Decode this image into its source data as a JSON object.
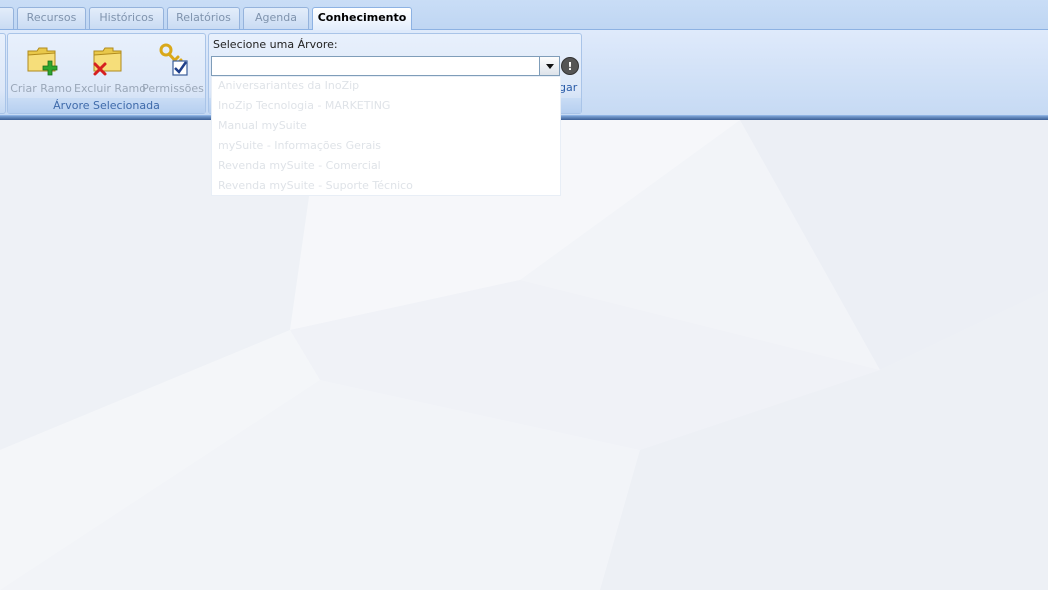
{
  "tabs": [
    {
      "label": "",
      "active": false
    },
    {
      "label": "Recursos",
      "active": false
    },
    {
      "label": "Históricos",
      "active": false
    },
    {
      "label": "Relatórios",
      "active": false
    },
    {
      "label": "Agenda",
      "active": false
    },
    {
      "label": "Conhecimento",
      "active": true
    }
  ],
  "ribbon": {
    "group_caption": "Árvore Selecionada",
    "buttons": [
      {
        "label": "Criar Ramo",
        "icon": "folder-add-icon"
      },
      {
        "label": "Excluir Ramo",
        "icon": "folder-delete-icon"
      },
      {
        "label": "Permissões",
        "icon": "key-check-icon"
      }
    ],
    "tree_select_label": "Selecione uma Árvore:",
    "tree_select_value": "",
    "partial_button_text": "gar"
  },
  "dropdown": {
    "items": [
      "Aniversariantes da InoZip",
      "InoZip Tecnologia - MARKETING",
      "Manual mySuite",
      "mySuite - Informações Gerais",
      "Revenda mySuite - Comercial",
      "Revenda mySuite - Suporte Técnico"
    ]
  },
  "colors": {
    "ribbon_bg": "#dfeafb",
    "tab_active_text": "#000000",
    "accent": "#15428b"
  }
}
